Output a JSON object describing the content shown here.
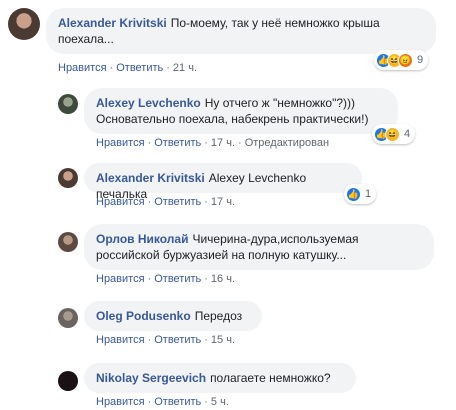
{
  "actions": {
    "like": "Нравится",
    "reply": "Ответить",
    "edited": "Отредактирован"
  },
  "comments": [
    {
      "author": "Alexander Krivitski",
      "text": "По-моему, так у неё немножко крыша поехала...",
      "time": "21 ч.",
      "reactions": "9"
    },
    {
      "author": "Alexey Levchenko",
      "text": "Ну отчего ж \"немножко\"?))) Основательно поехала, набекрень практически!)",
      "time": "17 ч.",
      "reactions": "4"
    },
    {
      "author": "Alexander Krivitski",
      "text": "Alexey Levchenko печалька",
      "time": "17 ч.",
      "reactions": "1"
    },
    {
      "author": "Орлов Николай",
      "text": "Чичерина-дура,используемая российской буржуазией на полную катушку...",
      "time": "16 ч."
    },
    {
      "author": "Oleg Podusenko",
      "text": "Передоз",
      "time": "15 ч."
    },
    {
      "author": "Nikolay Sergeevich",
      "text": "полагаете немножко?",
      "time": "5 ч."
    }
  ],
  "colors": {
    "link": "#385898",
    "bubble": "#f2f3f5",
    "meta": "#606770"
  },
  "icons": {
    "like": "thumbs-up-icon",
    "haha": "haha-face-icon",
    "angry": "angry-face-icon"
  }
}
